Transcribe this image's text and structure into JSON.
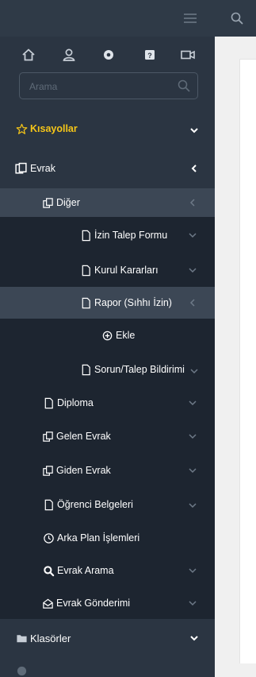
{
  "sidebar": {
    "search": {
      "placeholder": "Arama"
    },
    "icons": [
      "home-icon",
      "user-icon",
      "settings-icon",
      "help-icon",
      "video-icon"
    ],
    "menu": {
      "kisayollar": "Kısayollar",
      "evrak": "Evrak",
      "diger": "Diğer",
      "izin_talep_formu": "İzin Talep Formu",
      "kurul_kararlari": "Kurul Kararları",
      "rapor": "Rapor (Sıhhı İzin)",
      "ekle": "Ekle",
      "sorun_talep": "Sorun/Talep Bildirimi",
      "diploma": "Diploma",
      "gelen_evrak": "Gelen Evrak",
      "giden_evrak": "Giden Evrak",
      "ogrenci_belgeleri": "Öğrenci Belgeleri",
      "arka_plan": "Arka Plan İşlemleri",
      "evrak_arama": "Evrak Arama",
      "evrak_gonderimi": "Evrak Gönderimi",
      "klasorler": "Klasörler"
    }
  },
  "colors": {
    "sidebar_bg": "#2b3542",
    "submenu_bg": "#1d2530",
    "highlight_bg": "#3c4755",
    "accent_yellow": "#f5c518"
  }
}
